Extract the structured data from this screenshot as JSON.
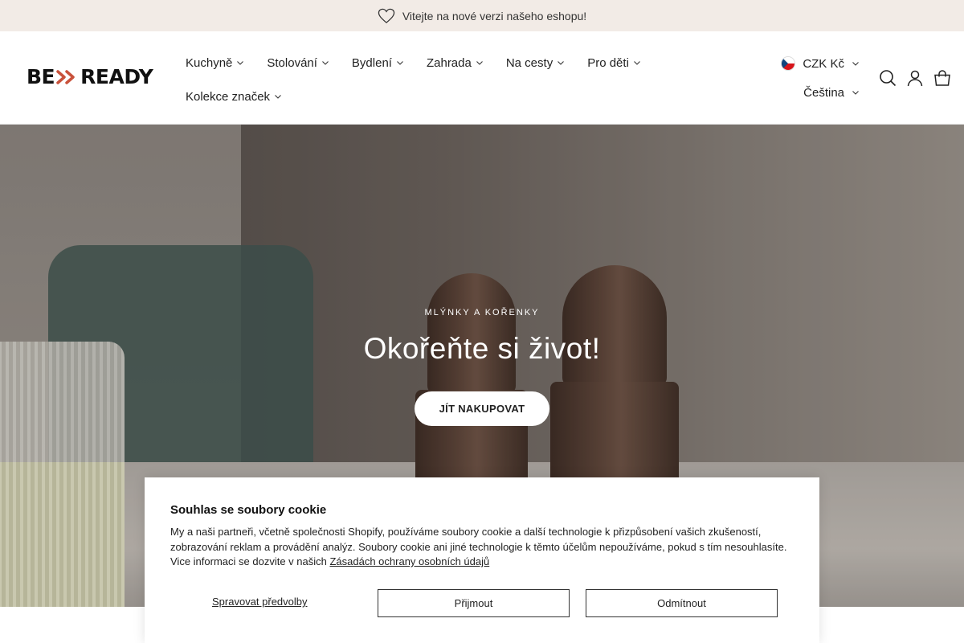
{
  "announcement": {
    "text": "Vitejte na nové verzi našeho eshopu!",
    "icon": "heart-icon"
  },
  "header": {
    "logo": {
      "left": "BE",
      "right": "READY",
      "accent_color": "#c9523b"
    },
    "nav": [
      {
        "label": "Kuchyně"
      },
      {
        "label": "Stolování"
      },
      {
        "label": "Bydlení"
      },
      {
        "label": "Zahrada"
      },
      {
        "label": "Na cesty"
      },
      {
        "label": "Pro děti"
      },
      {
        "label": "Kolekce značek"
      }
    ],
    "currency": {
      "label": "CZK Kč",
      "flag": "czech-flag-icon"
    },
    "language": {
      "label": "Čeština"
    },
    "icons": [
      "search-icon",
      "account-icon",
      "cart-icon"
    ]
  },
  "hero": {
    "eyebrow": "MLÝNKY A KOŘENKY",
    "title": "Okořeňte si život!",
    "button": "JÍT NAKUPOVAT"
  },
  "cookie": {
    "title": "Souhlas se soubory cookie",
    "text": "My a naši partneři, včetně společnosti Shopify, používáme soubory cookie a další technologie k přizpůsobení vašich zkušeností, zobrazování reklam a provádění analýz. Soubory cookie ani jiné technologie k těmto účelům nepoužíváme, pokud s tím nesouhlasíte. Vice informaci se dozvite v našich ",
    "link": "Zásadách ochrany osobních údajů",
    "manage": "Spravovat předvolby",
    "accept": "Přijmout",
    "decline": "Odmítnout"
  }
}
